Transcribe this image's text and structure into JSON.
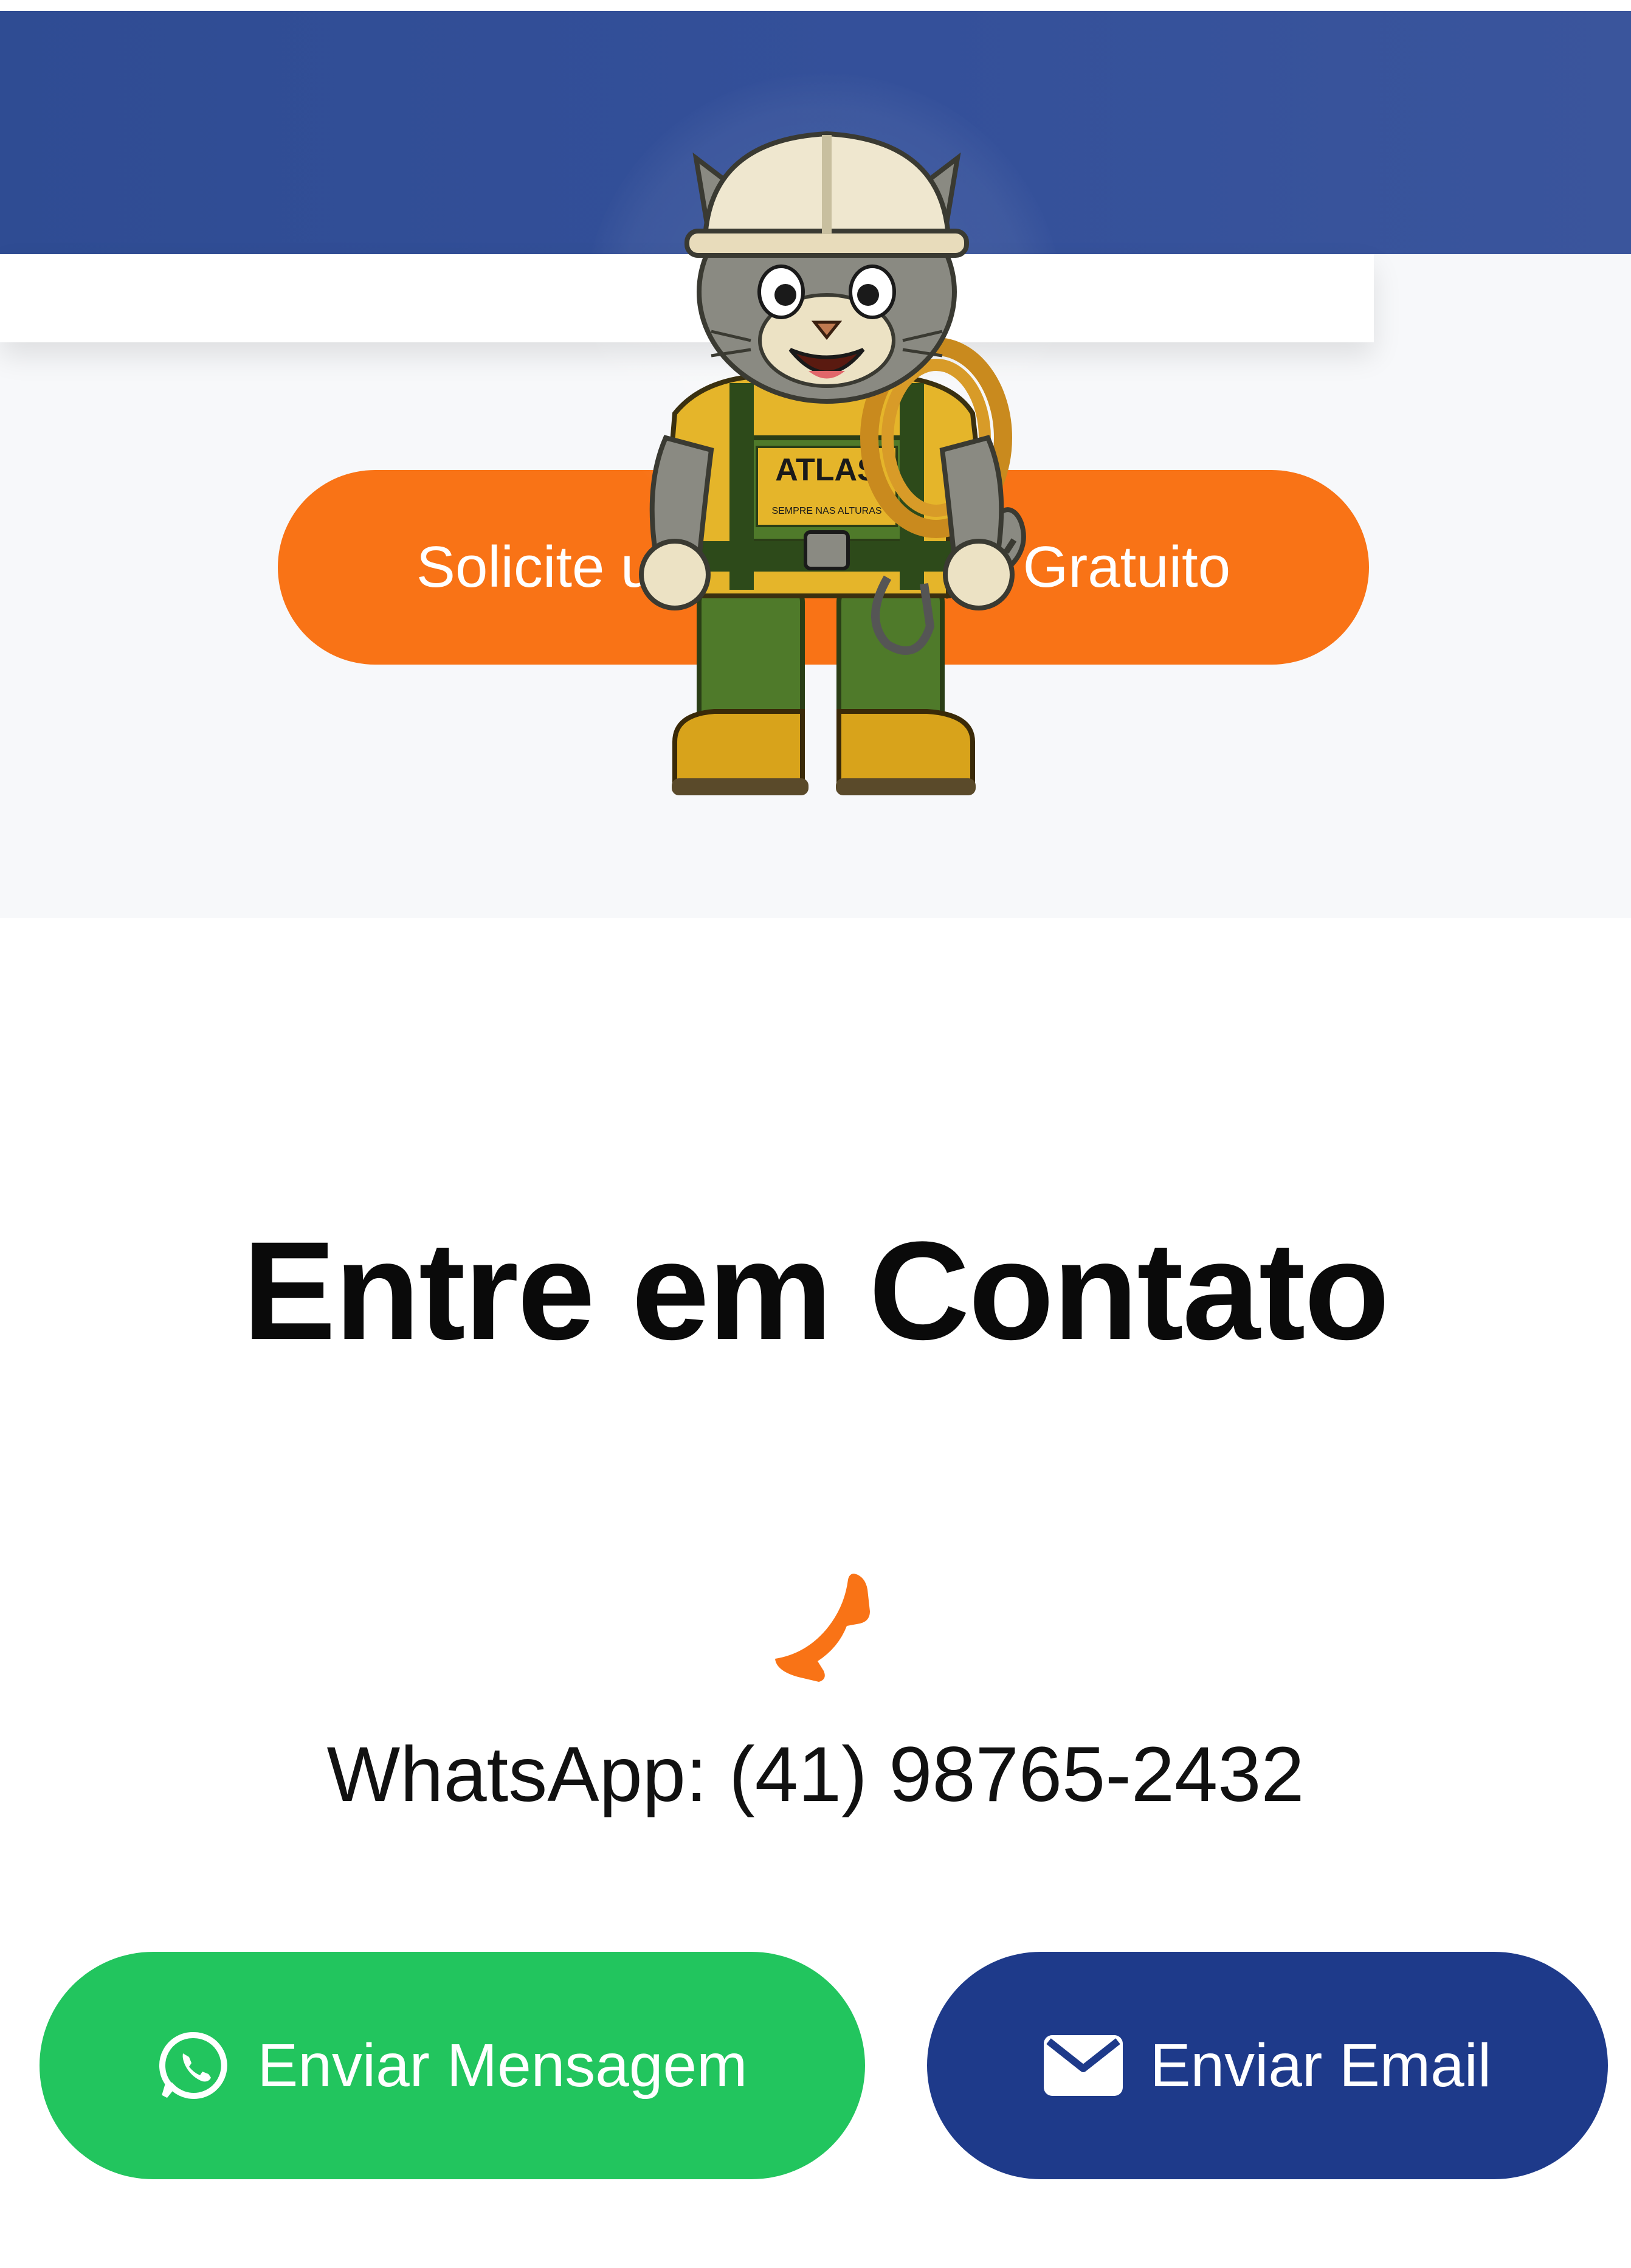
{
  "colors": {
    "hero_blue": "#34509a",
    "hero_gray": "#f7f8fa",
    "cta_orange": "#f97316",
    "whatsapp_green": "#22c55e",
    "email_navy": "#1e3a8a",
    "phone_icon_orange": "#f97316"
  },
  "hero": {
    "cta_label": "Solicite um Orçamento Gratuito",
    "mascot": {
      "icon": "cat-mascot-image",
      "vest_text": "ATLAS",
      "vest_subtext": "SEMPRE NAS ALTURAS"
    }
  },
  "contact": {
    "title": "Entre em Contato",
    "phone_icon": "phone-icon",
    "whatsapp_text": "WhatsApp: (41) 98765-2432",
    "buttons": {
      "whatsapp_label": "Enviar Mensagem",
      "whatsapp_icon": "whatsapp-icon",
      "email_label": "Enviar Email",
      "email_icon": "envelope-icon"
    }
  }
}
